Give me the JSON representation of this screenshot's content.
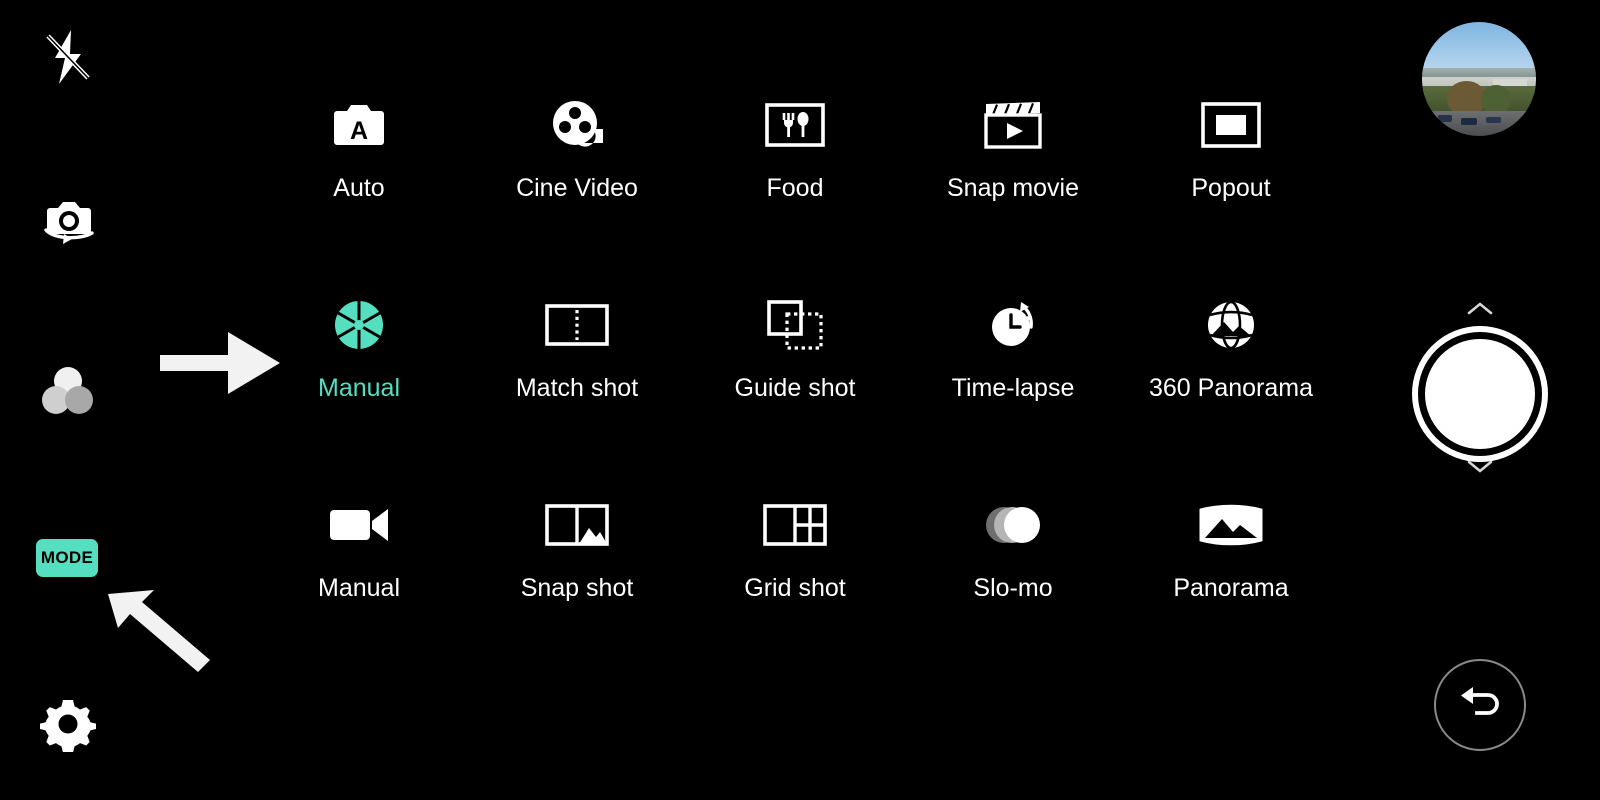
{
  "app": {
    "title": "Camera mode selection",
    "background_color": "#000000",
    "accent_color": "#55dfc0",
    "icon_color": "#ffffff"
  },
  "left_rail": {
    "items": [
      {
        "name": "flash-off",
        "icon": "flash-off-icon",
        "label": "Flash off"
      },
      {
        "name": "switch-camera",
        "icon": "switch-camera-icon",
        "label": "Switch camera"
      },
      {
        "name": "filters",
        "icon": "filters-icon",
        "label": "Filters"
      },
      {
        "name": "mode",
        "icon": "mode-badge",
        "label": "MODE"
      },
      {
        "name": "settings",
        "icon": "gear-icon",
        "label": "Settings"
      }
    ],
    "mode_badge_label": "MODE"
  },
  "mode_grid": {
    "rows": 3,
    "columns": 5,
    "selected": "Manual",
    "modes": [
      {
        "label": "Auto",
        "icon": "camera-auto-icon",
        "selected": false,
        "row": 1,
        "col": 1
      },
      {
        "label": "Cine Video",
        "icon": "film-reel-icon",
        "selected": false,
        "row": 1,
        "col": 2
      },
      {
        "label": "Food",
        "icon": "fork-spoon-icon",
        "selected": false,
        "row": 1,
        "col": 3
      },
      {
        "label": "Snap movie",
        "icon": "clapperboard-icon",
        "selected": false,
        "row": 1,
        "col": 4
      },
      {
        "label": "Popout",
        "icon": "popout-frame-icon",
        "selected": false,
        "row": 1,
        "col": 5
      },
      {
        "label": "Manual",
        "icon": "aperture-icon",
        "selected": true,
        "row": 2,
        "col": 1
      },
      {
        "label": "Match shot",
        "icon": "match-shot-icon",
        "selected": false,
        "row": 2,
        "col": 2
      },
      {
        "label": "Guide shot",
        "icon": "guide-shot-icon",
        "selected": false,
        "row": 2,
        "col": 3
      },
      {
        "label": "Time-lapse",
        "icon": "timelapse-clock-icon",
        "selected": false,
        "row": 2,
        "col": 4
      },
      {
        "label": "360 Panorama",
        "icon": "globe-panorama-icon",
        "selected": false,
        "row": 2,
        "col": 5
      },
      {
        "label": "Manual",
        "icon": "video-camera-icon",
        "selected": false,
        "row": 3,
        "col": 1
      },
      {
        "label": "Snap shot",
        "icon": "snap-shot-icon",
        "selected": false,
        "row": 3,
        "col": 2
      },
      {
        "label": "Grid shot",
        "icon": "grid-shot-icon",
        "selected": false,
        "row": 3,
        "col": 3
      },
      {
        "label": "Slo-mo",
        "icon": "slomo-circles-icon",
        "selected": false,
        "row": 3,
        "col": 4
      },
      {
        "label": "Panorama",
        "icon": "panorama-icon",
        "selected": false,
        "row": 3,
        "col": 5
      }
    ]
  },
  "right_controls": {
    "gallery_thumbnail": {
      "name": "gallery-thumbnail",
      "description": "Outdoor landscape photo"
    },
    "shutter": {
      "name": "shutter-button"
    },
    "chevron_up": {
      "name": "chevron-up-icon"
    },
    "chevron_down": {
      "name": "chevron-down-icon"
    },
    "back": {
      "name": "back-button",
      "icon": "undo-arrow-icon"
    }
  },
  "annotations": [
    {
      "name": "arrow-right",
      "points_to": "Manual",
      "direction": "right"
    },
    {
      "name": "arrow-diagonal",
      "points_to": "MODE",
      "direction": "up-left"
    }
  ]
}
